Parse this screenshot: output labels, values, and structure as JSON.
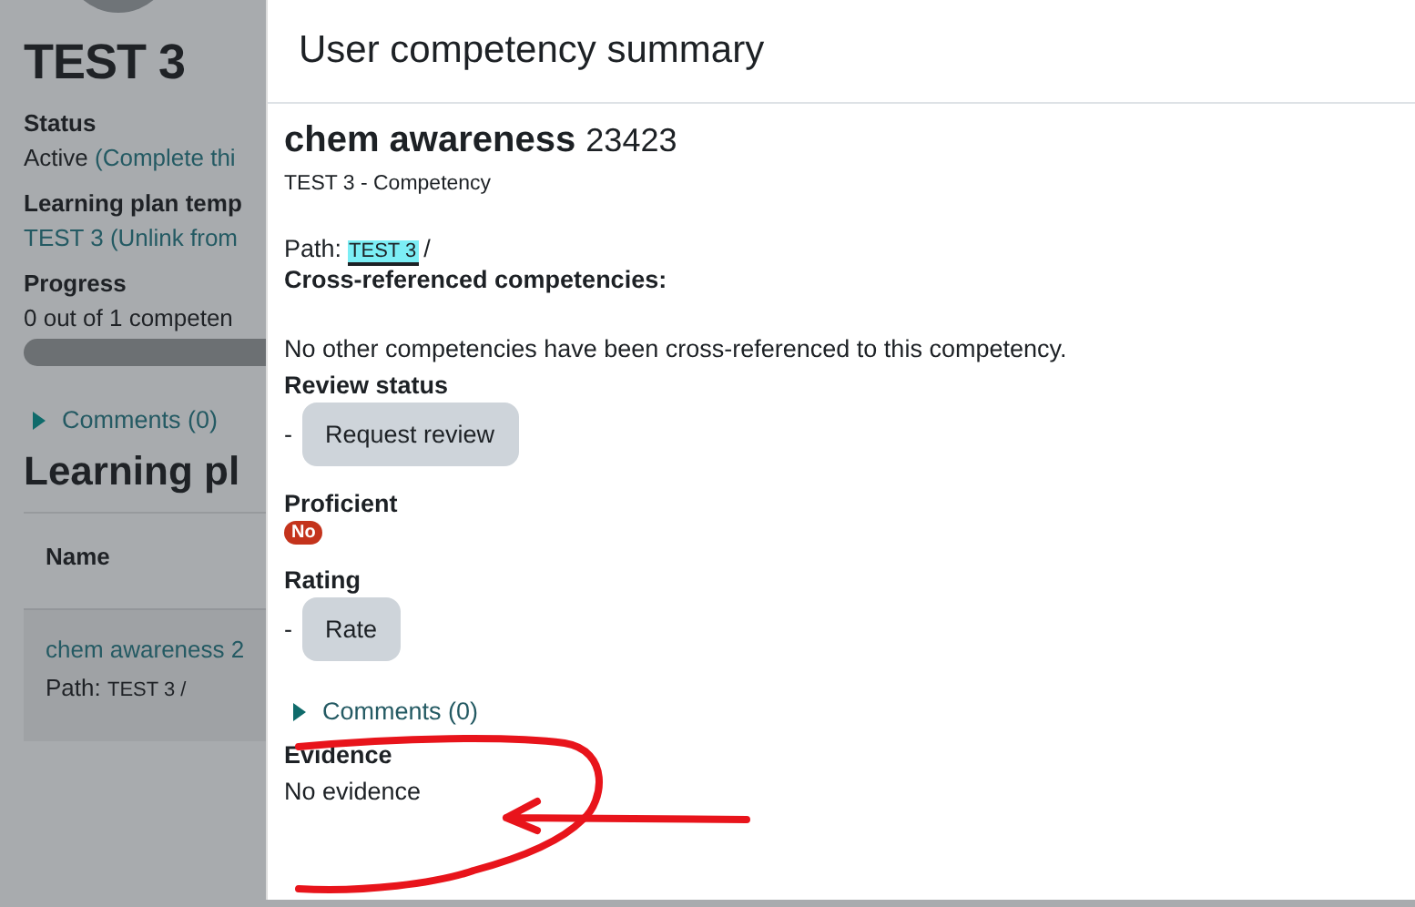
{
  "background_page": {
    "title": "TEST 3",
    "fields": [
      {
        "label": "Status",
        "value": "Active ",
        "link": "(Complete thi"
      },
      {
        "label": "Learning plan temp",
        "link": "TEST 3 (Unlink from"
      },
      {
        "label": "Progress",
        "value": "0 out of 1 competen"
      }
    ],
    "comments": {
      "label": "Comments (0)",
      "expanded": false
    },
    "section_title": "Learning pl",
    "table": {
      "columns": [
        "Name"
      ],
      "rows": [
        {
          "competency": "chem awareness 2",
          "path_label": "Path:",
          "path_link": "TEST 3 /"
        }
      ]
    }
  },
  "dialog": {
    "title": "User competency summary",
    "competency": {
      "name": "chem awareness",
      "idnumber": "23423",
      "framework": "TEST 3 - Competency"
    },
    "path": {
      "label": "Path:",
      "link": "TEST 3",
      "separator": "/",
      "highlighted": true
    },
    "cross_referenced": {
      "heading": "Cross-referenced competencies:",
      "text": "No other competencies have been cross-referenced to this competency."
    },
    "review_status": {
      "heading": "Review status",
      "value": "-",
      "button": "Request review"
    },
    "proficient": {
      "heading": "Proficient",
      "badge": "No"
    },
    "rating": {
      "heading": "Rating",
      "value": "-",
      "button": "Rate"
    },
    "comments": {
      "label": "Comments (0)",
      "expanded": false
    },
    "evidence": {
      "heading": "Evidence",
      "text": "No evidence"
    }
  }
}
